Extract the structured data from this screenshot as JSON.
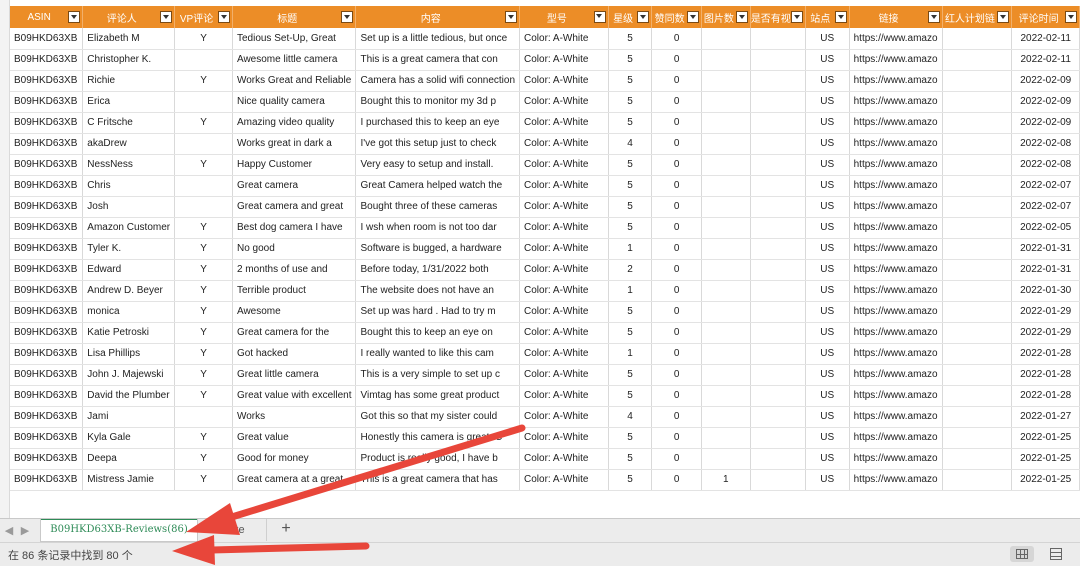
{
  "columns": [
    {
      "label": "ASIN",
      "filter": "dropdown"
    },
    {
      "label": "评论人",
      "filter": "dropdown"
    },
    {
      "label": "VP评论",
      "filter": "dropdown"
    },
    {
      "label": "标题",
      "filter": "dropdown"
    },
    {
      "label": "内容",
      "filter": "dropdown"
    },
    {
      "label": "型号",
      "filter": "active-filter"
    },
    {
      "label": "星级",
      "filter": "dropdown"
    },
    {
      "label": "赞同数",
      "filter": "dropdown"
    },
    {
      "label": "图片数",
      "filter": "dropdown"
    },
    {
      "label": "是否有视",
      "filter": "dropdown"
    },
    {
      "label": "站点",
      "filter": "dropdown"
    },
    {
      "label": "链接",
      "filter": "dropdown"
    },
    {
      "label": "红人计划链",
      "filter": "dropdown"
    },
    {
      "label": "评论时间",
      "filter": "dropdown"
    }
  ],
  "rows": [
    [
      "B09HKD63XB",
      "Elizabeth M",
      "Y",
      "Tedious Set-Up, Great",
      "Set up is a little tedious, but once",
      "Color: A-White",
      "5",
      "0",
      "",
      "",
      "US",
      "https://www.amazo",
      "",
      "2022-02-11"
    ],
    [
      "B09HKD63XB",
      "Christopher K.",
      "",
      "Awesome little camera",
      "This is a great camera that con",
      "Color: A-White",
      "5",
      "0",
      "",
      "",
      "US",
      "https://www.amazo",
      "",
      "2022-02-11"
    ],
    [
      "B09HKD63XB",
      "Richie",
      "Y",
      "Works Great and Reliable",
      "Camera has a solid wifi connection",
      "Color: A-White",
      "5",
      "0",
      "",
      "",
      "US",
      "https://www.amazo",
      "",
      "2022-02-09"
    ],
    [
      "B09HKD63XB",
      "Erica",
      "",
      "Nice quality camera",
      "Bought this to monitor my 3d p",
      "Color: A-White",
      "5",
      "0",
      "",
      "",
      "US",
      "https://www.amazo",
      "",
      "2022-02-09"
    ],
    [
      "B09HKD63XB",
      "C Fritsche",
      "Y",
      "Amazing video quality",
      "I purchased this to keep an eye",
      "Color: A-White",
      "5",
      "0",
      "",
      "",
      "US",
      "https://www.amazo",
      "",
      "2022-02-09"
    ],
    [
      "B09HKD63XB",
      "akaDrew",
      "",
      "Works great in dark a",
      "I've got this setup just to check",
      "Color: A-White",
      "4",
      "0",
      "",
      "",
      "US",
      "https://www.amazo",
      "",
      "2022-02-08"
    ],
    [
      "B09HKD63XB",
      "NessNess",
      "Y",
      "Happy Customer",
      "Very easy to setup and install.",
      "Color: A-White",
      "5",
      "0",
      "",
      "",
      "US",
      "https://www.amazo",
      "",
      "2022-02-08"
    ],
    [
      "B09HKD63XB",
      "Chris",
      "",
      "Great camera",
      "Great Camera helped watch the",
      "Color: A-White",
      "5",
      "0",
      "",
      "",
      "US",
      "https://www.amazo",
      "",
      "2022-02-07"
    ],
    [
      "B09HKD63XB",
      "Josh",
      "",
      "Great camera and great",
      "Bought three of these cameras",
      "Color: A-White",
      "5",
      "0",
      "",
      "",
      "US",
      "https://www.amazo",
      "",
      "2022-02-07"
    ],
    [
      "B09HKD63XB",
      "Amazon Customer",
      "Y",
      "Best dog camera I have",
      "I wsh when room is not too dar",
      "Color: A-White",
      "5",
      "0",
      "",
      "",
      "US",
      "https://www.amazo",
      "",
      "2022-02-05"
    ],
    [
      "B09HKD63XB",
      "Tyler K.",
      "Y",
      "No good",
      "Software is bugged, a hardware",
      "Color: A-White",
      "1",
      "0",
      "",
      "",
      "US",
      "https://www.amazo",
      "",
      "2022-01-31"
    ],
    [
      "B09HKD63XB",
      "Edward",
      "Y",
      "2 months of use and",
      "Before today, 1/31/2022 both",
      "Color: A-White",
      "2",
      "0",
      "",
      "",
      "US",
      "https://www.amazo",
      "",
      "2022-01-31"
    ],
    [
      "B09HKD63XB",
      "Andrew D. Beyer",
      "Y",
      "Terrible product",
      "The website does not have an",
      "Color: A-White",
      "1",
      "0",
      "",
      "",
      "US",
      "https://www.amazo",
      "",
      "2022-01-30"
    ],
    [
      "B09HKD63XB",
      "monica",
      "Y",
      "Awesome",
      "Set up was hard . Had to try m",
      "Color: A-White",
      "5",
      "0",
      "",
      "",
      "US",
      "https://www.amazo",
      "",
      "2022-01-29"
    ],
    [
      "B09HKD63XB",
      "Katie Petroski",
      "Y",
      "Great camera for the",
      "Bought this to keep an eye on",
      "Color: A-White",
      "5",
      "0",
      "",
      "",
      "US",
      "https://www.amazo",
      "",
      "2022-01-29"
    ],
    [
      "B09HKD63XB",
      "Lisa Phillips",
      "Y",
      "Got hacked",
      "I really wanted to like this cam",
      "Color: A-White",
      "1",
      "0",
      "",
      "",
      "US",
      "https://www.amazo",
      "",
      "2022-01-28"
    ],
    [
      "B09HKD63XB",
      "John J. Majewski",
      "Y",
      "Great little camera",
      "This is a very simple to set up c",
      "Color: A-White",
      "5",
      "0",
      "",
      "",
      "US",
      "https://www.amazo",
      "",
      "2022-01-28"
    ],
    [
      "B09HKD63XB",
      "David the Plumber",
      "Y",
      "Great value with excellent",
      "Vimtag has some great product",
      "Color: A-White",
      "5",
      "0",
      "",
      "",
      "US",
      "https://www.amazo",
      "",
      "2022-01-28"
    ],
    [
      "B09HKD63XB",
      "Jami",
      "",
      "Works",
      "Got this so that my sister could",
      "Color: A-White",
      "4",
      "0",
      "",
      "",
      "US",
      "https://www.amazo",
      "",
      "2022-01-27"
    ],
    [
      "B09HKD63XB",
      "Kyla Gale",
      "Y",
      "Great value",
      "Honestly this camera is great. C",
      "Color: A-White",
      "5",
      "0",
      "",
      "",
      "US",
      "https://www.amazo",
      "",
      "2022-01-25"
    ],
    [
      "B09HKD63XB",
      "Deepa",
      "Y",
      "Good for money",
      "Product is really good, I have b",
      "Color: A-White",
      "5",
      "0",
      "",
      "",
      "US",
      "https://www.amazo",
      "",
      "2022-01-25"
    ],
    [
      "B09HKD63XB",
      "Mistress Jamie",
      "Y",
      "Great camera at a great",
      "This is a great camera that has",
      "Color: A-White",
      "5",
      "0",
      "1",
      "",
      "US",
      "https://www.amazo",
      "",
      "2022-01-25"
    ]
  ],
  "tabs": {
    "active": "B09HKD63XB-Reviews(86)",
    "note": "Note",
    "add": "+"
  },
  "status": {
    "text": "在 86 条记录中找到 80 个"
  },
  "colors": {
    "header_bg": "#ec8d27",
    "active_tab_text": "#2e8b57",
    "arrow": "#e8463a"
  }
}
